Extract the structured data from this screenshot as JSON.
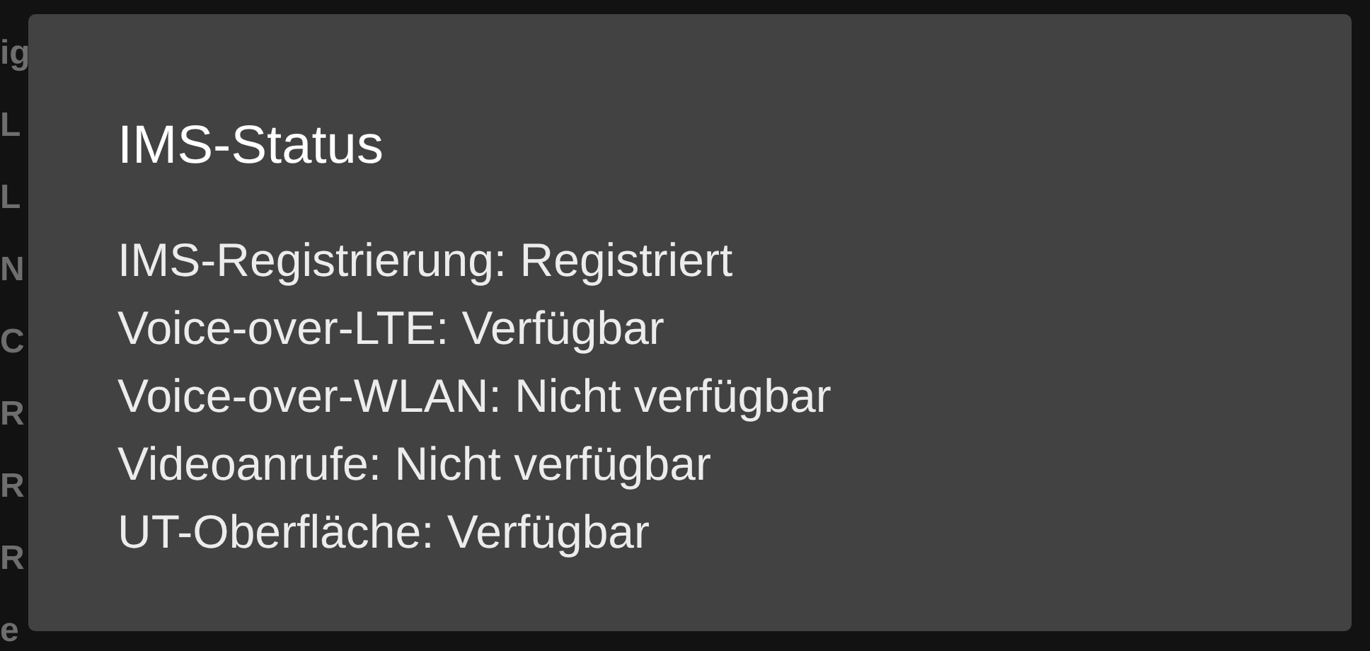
{
  "background_list": [
    "ig",
    "L",
    "L",
    "N",
    "C",
    "R",
    "R",
    "R",
    "e"
  ],
  "dialog": {
    "title": "IMS-Status",
    "lines": [
      "IMS-Registrierung: Registriert",
      "Voice-over-LTE: Verfügbar",
      "Voice-over-WLAN: Nicht verfügbar",
      "Videoanrufe: Nicht verfügbar",
      "UT-Oberfläche: Verfügbar"
    ]
  }
}
